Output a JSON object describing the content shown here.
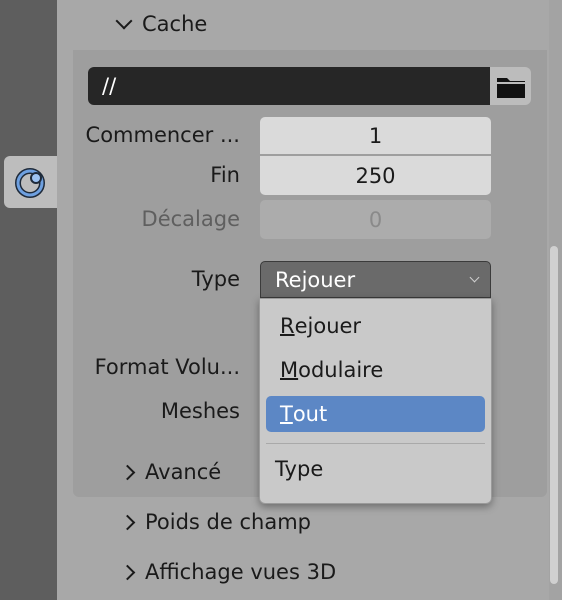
{
  "sidebar": {
    "tab_icon": "physics-cache-icon"
  },
  "cache_section": {
    "title": "Cache",
    "path_value": "//",
    "folder_icon": "folder-icon"
  },
  "fields": {
    "start_label": "Commencer ...",
    "start_value": "1",
    "end_label": "Fin",
    "end_value": "250",
    "offset_label": "Décalage",
    "offset_value": "0",
    "type_label": "Type",
    "type_value": "Rejouer",
    "format_label": "Format Volu...",
    "meshes_label": "Meshes"
  },
  "type_menu": {
    "items": [
      {
        "label": "Rejouer",
        "mnemonic": "R",
        "rest": "ejouer"
      },
      {
        "label": "Modulaire",
        "mnemonic": "M",
        "rest": "odulaire"
      },
      {
        "label": "Tout",
        "mnemonic": "T",
        "rest": "out"
      }
    ],
    "selected": "Tout",
    "footer": "Type"
  },
  "subsections": {
    "advanced": "Avancé",
    "field_weights": "Poids de champ",
    "viewport_display": "Affichage vues 3D"
  },
  "colors": {
    "selection": "#5c87c5",
    "field_bg": "#dadada",
    "path_bg": "#262626"
  }
}
